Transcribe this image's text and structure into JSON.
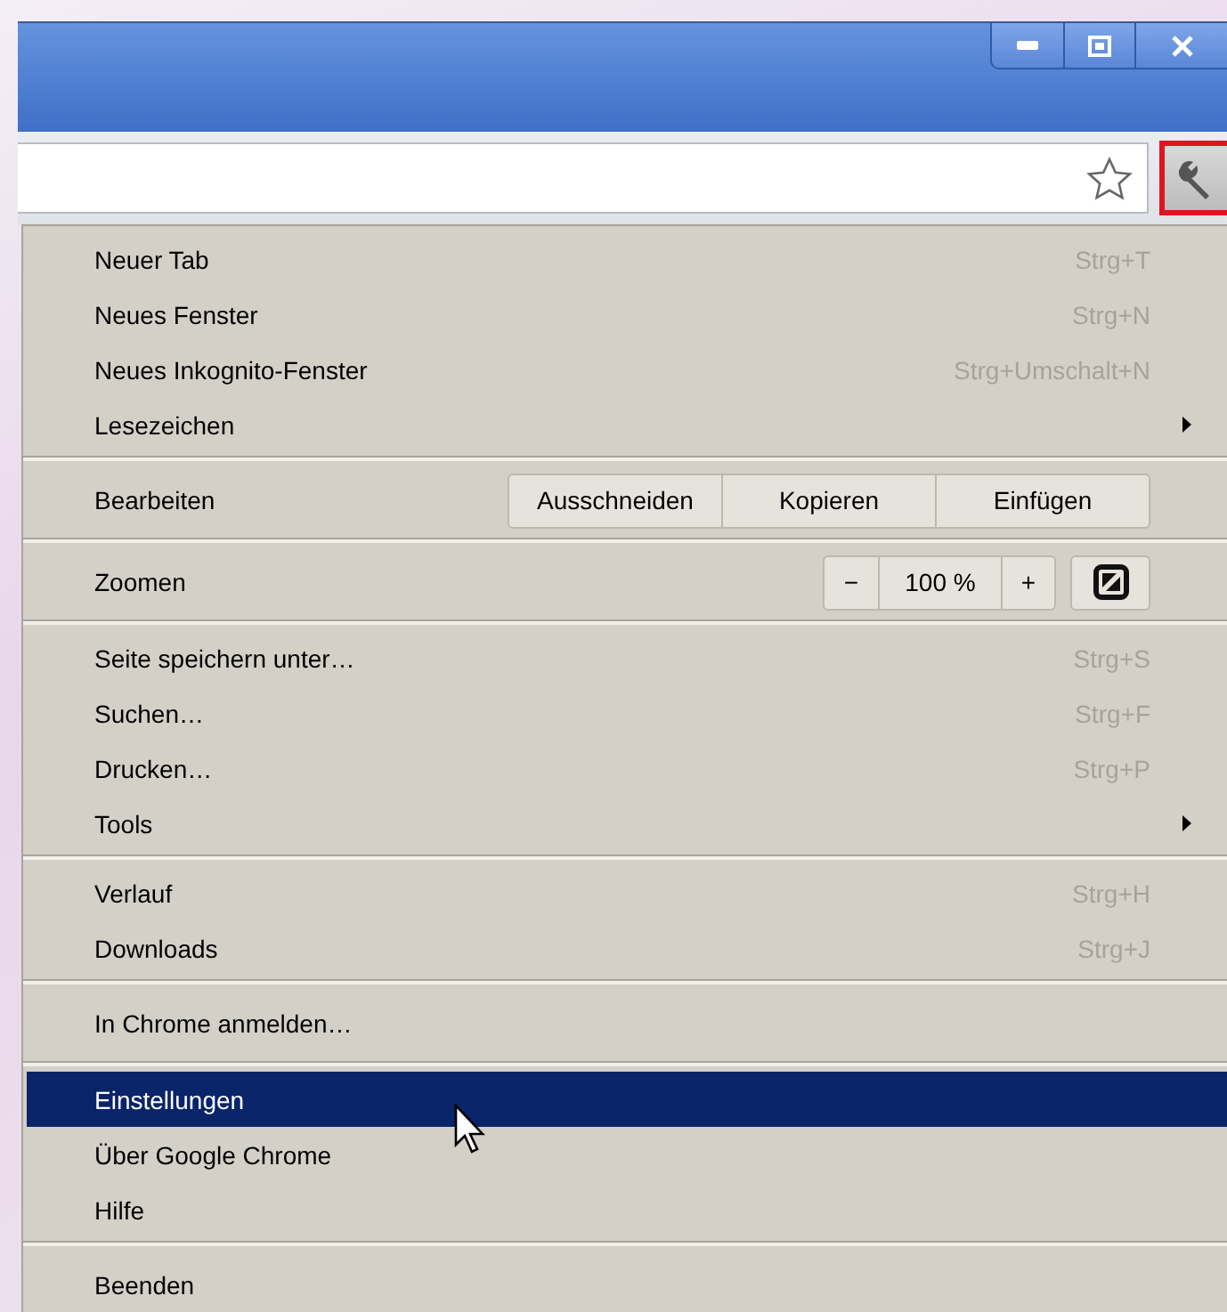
{
  "window": {
    "controls": [
      {
        "kind": "minimize"
      },
      {
        "kind": "maximize"
      },
      {
        "kind": "close"
      }
    ]
  },
  "toolbar": {
    "menu_button": {
      "highlighted": true
    }
  },
  "menu": {
    "groups": [
      {
        "items": [
          {
            "kind": "command",
            "label": "Neuer Tab",
            "shortcut": "Strg+T",
            "submenu": false,
            "selected": false
          },
          {
            "kind": "command",
            "label": "Neues Fenster",
            "shortcut": "Strg+N",
            "submenu": false,
            "selected": false
          },
          {
            "kind": "command",
            "label": "Neues Inkognito-Fenster",
            "shortcut": "Strg+Umschalt+N",
            "submenu": false,
            "selected": false
          },
          {
            "kind": "command",
            "label": "Lesezeichen",
            "submenu": true,
            "selected": false
          }
        ]
      },
      {
        "items": [
          {
            "kind": "edit",
            "label": "Bearbeiten",
            "buttons": [
              "Ausschneiden",
              "Kopieren",
              "Einfügen"
            ]
          }
        ]
      },
      {
        "items": [
          {
            "kind": "zoom",
            "label": "Zoomen",
            "minus": "−",
            "value": "100 %",
            "plus": "+"
          }
        ]
      },
      {
        "items": [
          {
            "kind": "command",
            "label": "Seite speichern unter…",
            "shortcut": "Strg+S",
            "submenu": false,
            "selected": false
          },
          {
            "kind": "command",
            "label": "Suchen…",
            "shortcut": "Strg+F",
            "submenu": false,
            "selected": false
          },
          {
            "kind": "command",
            "label": "Drucken…",
            "shortcut": "Strg+P",
            "submenu": false,
            "selected": false
          },
          {
            "kind": "command",
            "label": "Tools",
            "submenu": true,
            "selected": false
          }
        ]
      },
      {
        "items": [
          {
            "kind": "command",
            "label": "Verlauf",
            "shortcut": "Strg+H",
            "submenu": false,
            "selected": false
          },
          {
            "kind": "command",
            "label": "Downloads",
            "shortcut": "Strg+J",
            "submenu": false,
            "selected": false
          }
        ]
      },
      {
        "items": [
          {
            "kind": "command",
            "label": "In Chrome anmelden…",
            "submenu": false,
            "selected": false
          }
        ]
      },
      {
        "items": [
          {
            "kind": "command",
            "label": "Einstellungen",
            "submenu": false,
            "selected": true
          },
          {
            "kind": "command",
            "label": "Über Google Chrome",
            "submenu": false,
            "selected": false
          },
          {
            "kind": "command",
            "label": "Hilfe",
            "submenu": false,
            "selected": false
          }
        ]
      },
      {
        "items": [
          {
            "kind": "command",
            "label": "Beenden",
            "submenu": false,
            "selected": false
          }
        ]
      }
    ]
  }
}
